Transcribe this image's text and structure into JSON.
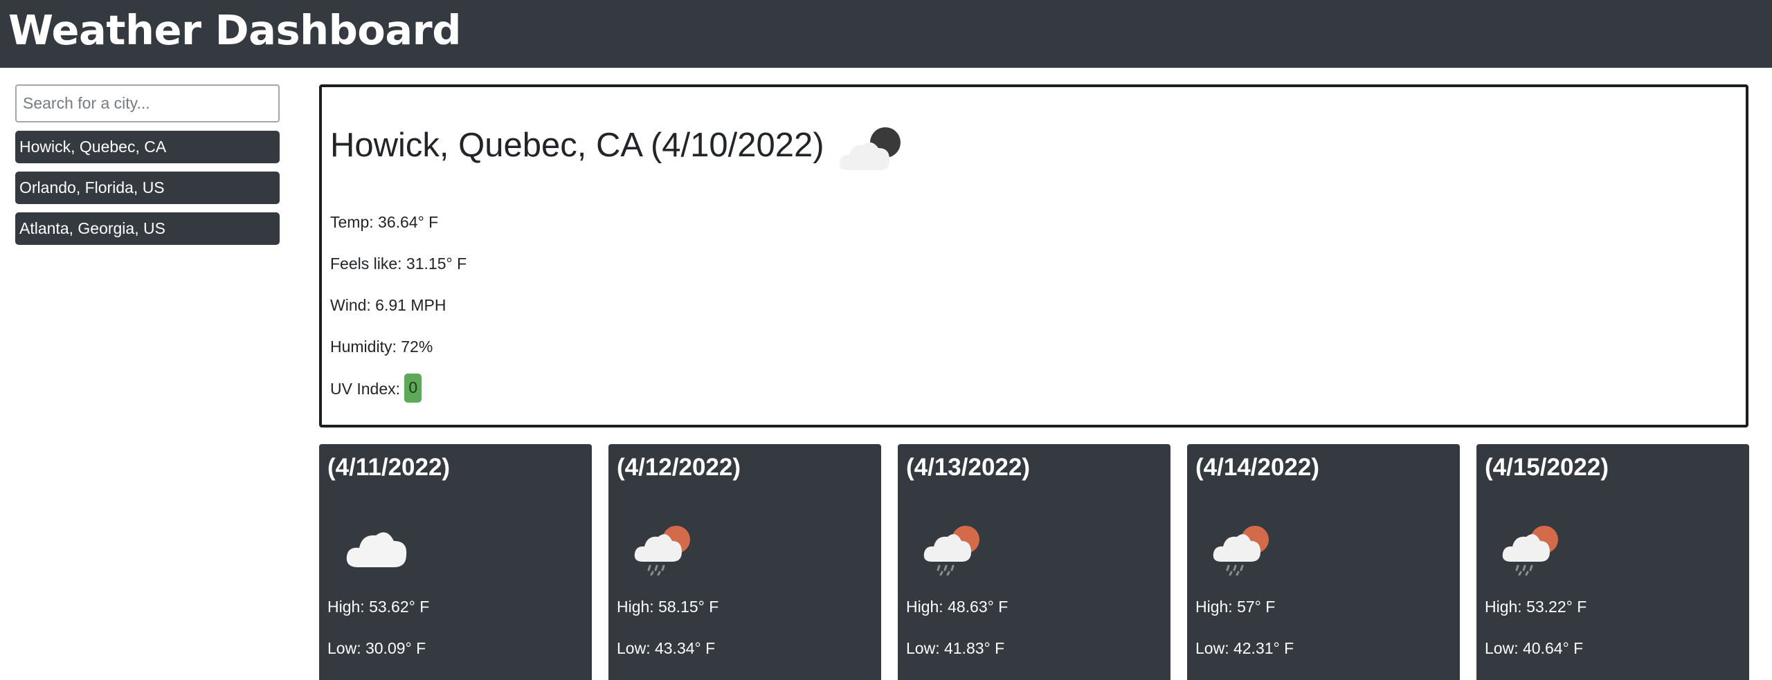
{
  "header": {
    "title": "Weather Dashboard"
  },
  "search": {
    "placeholder": "Search for a city...",
    "value": ""
  },
  "history": [
    {
      "label": "Howick, Quebec, CA"
    },
    {
      "label": "Orlando, Florida, US"
    },
    {
      "label": "Atlanta, Georgia, US"
    }
  ],
  "current": {
    "title": "Howick, Quebec, CA (4/10/2022)",
    "icon": "night-partly-cloudy-icon",
    "temp": "Temp: 36.64° F",
    "feels_like": "Feels like: 31.15° F",
    "wind": "Wind: 6.91 MPH",
    "humidity": "Humidity: 72%",
    "uv_label": "UV Index:",
    "uv_value": "0",
    "uv_color": "#5ea85a"
  },
  "forecast": [
    {
      "date": "(4/11/2022)",
      "icon": "cloud-icon",
      "high": "High: 53.62° F",
      "low": "Low: 30.09° F"
    },
    {
      "date": "(4/12/2022)",
      "icon": "sun-cloud-rain-icon",
      "high": "High: 58.15° F",
      "low": "Low: 43.34° F"
    },
    {
      "date": "(4/13/2022)",
      "icon": "sun-cloud-rain-icon",
      "high": "High: 48.63° F",
      "low": "Low: 41.83° F"
    },
    {
      "date": "(4/14/2022)",
      "icon": "sun-cloud-rain-icon",
      "high": "High: 57° F",
      "low": "Low: 42.31° F"
    },
    {
      "date": "(4/15/2022)",
      "icon": "sun-cloud-rain-icon",
      "high": "High: 53.22° F",
      "low": "Low: 40.64° F"
    }
  ],
  "colors": {
    "header_bg": "#343a40",
    "card_bg": "#343a40",
    "uv_badge": "#5ea85a",
    "sun": "#d36b4b"
  }
}
